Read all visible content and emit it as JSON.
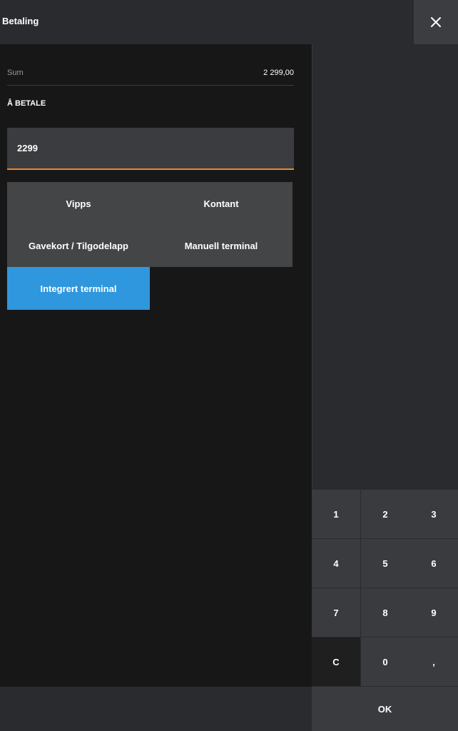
{
  "header": {
    "title": "Betaling",
    "close_icon": "close-icon"
  },
  "summary": {
    "sum_label": "Sum",
    "sum_value": "2 299,00",
    "to_pay_label": "Å BETALE"
  },
  "amount": {
    "value": "2299",
    "underline_color": "#f08a24"
  },
  "payment_methods": [
    {
      "label": "Vipps"
    },
    {
      "label": "Kontant"
    },
    {
      "label": "Gavekort / Tilgodelapp"
    },
    {
      "label": "Manuell terminal"
    },
    {
      "label": "Integrert terminal",
      "selected": true
    }
  ],
  "keypad": {
    "keys": [
      "1",
      "2",
      "3",
      "4",
      "5",
      "6",
      "7",
      "8",
      "9",
      "C",
      "0",
      ","
    ],
    "ok_label": "OK"
  },
  "colors": {
    "accent": "#2e97dd",
    "input_underline": "#f08a24"
  }
}
